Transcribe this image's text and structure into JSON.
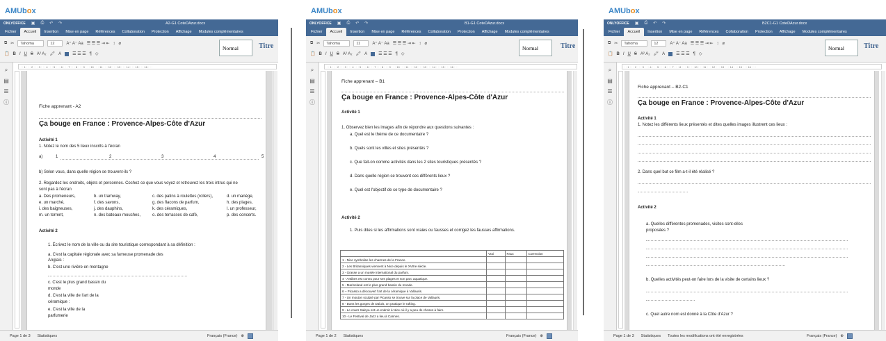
{
  "brand": {
    "a": "AMUb",
    "o": "o",
    "x": "x"
  },
  "onlyoffice": "ONLYOFFICE",
  "menu": [
    "Fichier",
    "Accueil",
    "Insertion",
    "Mise en page",
    "Références",
    "Collaboration",
    "Protection",
    "Affichage",
    "Modules complémentaires"
  ],
  "toolbar": {
    "font": "Tahoma",
    "style_normal": "Normal",
    "style_titre": "Titre"
  },
  "panes": [
    {
      "doc_title": "A2-G1 CoteDAzur.docx",
      "font_size": "12",
      "page": "Page 1 de 3",
      "stats": "Statistiques",
      "lang": "Français (France)",
      "saved": ""
    },
    {
      "doc_title": "B1-G1 CoteDAzur.docx",
      "font_size": "11",
      "page": "Page 1 de 2",
      "stats": "Statistiques",
      "lang": "Français (France)",
      "saved": ""
    },
    {
      "doc_title": "B2C1-G1 CoteDAzur.docx",
      "font_size": "12",
      "page": "Page 1 de 3",
      "stats": "Statistiques",
      "lang": "Français (France)",
      "saved": "Toutes les modifications ont été enregistrées"
    }
  ],
  "doc1": {
    "header": "Fiche apprenant - A2",
    "title": "Ça bouge en France : Provence-Alpes-Côte d'Azur",
    "act1": "Activité 1",
    "q1": "1. Notez le nom des 5 lieux inscrits à l'écran",
    "a_label": "a)",
    "nums": [
      "1",
      "2",
      "3",
      "4",
      "5"
    ],
    "b_line": "b)       Selon vous, dans quelle région se trouvent-ils ?",
    "q2a": "2. Regardez les endroits, objets et personnes. Cochez ce que vous voyez et retrouvez les trois intrus qui ne",
    "q2b": "sont pas à l'écran",
    "grid": [
      [
        "a. Des promeneurs,",
        "b. un tramway,",
        "c. des patins à roulettes (rollers),",
        "d. un manège,"
      ],
      [
        "e. un marché,",
        "f. des savons,",
        "g. des flacons de parfum,",
        "h. des plages,"
      ],
      [
        "i. des baigneuses,",
        "j. des dauphins,",
        "k. des céramiques,",
        "l. un professeur,"
      ],
      [
        "m. un torrent,",
        "n. des bateaux mouches,",
        "o. des terrasses de café,",
        "p. des concerts."
      ]
    ],
    "act2": "Activité 2",
    "q21": "1.   Écrivez le nom de la ville ou du site touristique correspondant à sa définition :",
    "qa1": "a.   C'est la capitale régionale avec sa fameuse promenade des",
    "qa2": "Anglais :",
    "qb": "b.   C'est une rivière en montagne",
    "qc1": "c.   C'est le plus grand bassin du",
    "qc2": "monde",
    "qd1": "d.   C'est la ville de l'art de la",
    "qd2": "céramique :",
    "qe1": "e.   C'est la ville de la",
    "qe2": "parfumerie"
  },
  "doc2": {
    "header": "Fiche apprenant – B1",
    "title": "Ça bouge en France :  Provence-Alpes-Côte d'Azur",
    "act1": "Activité 1",
    "q1": "1. Observez bien les images afin de répondre aux questions suivantes :",
    "subs": [
      "a.   Quel est le thème de ce documentaire ?",
      "b.   Quels sont les villes et sites présentés ?",
      "c.   Que fait-on comme activités dans les 2 sites touristiques présentés ?",
      "d.   Dans quelle région se trouvent ces différents lieux ?",
      "e.   Quel est l'objectif de ce type de documentaire ?"
    ],
    "act2": "Activité 2",
    "q2": "1.   Puis dites si les affirmations sont vraies ou fausses et corrigez les fausses affirmations.",
    "cols": [
      "Vrai",
      "Faux",
      "Correction"
    ],
    "rows": [
      "1 - Nice symbolise les charmes de la France.",
      "2 - Les Britanniques viennent à Nice depuis le XVIIIe siècle.",
      "3 - Grasse a un musée international du parfum.",
      "4 - Antibes est connu pour ses plages et son parc aquatique.",
      "5 - Marineland est le plus grand bassin du monde.",
      "6 – Picasso a découvert l'art de la céramique à Vallauris.",
      "7 - Un mouton sculpté par Picasso se trouve sur la place de Vallauris.",
      "8 - Dans les gorges de Daluis, on pratique le rafting.",
      "9 - Le cours Saleya est un endroit à Nice où il y a peu de choses à faire.",
      "10 - Le Festival de Jazz a lieu à Cannes."
    ]
  },
  "doc3": {
    "header": "Fiche apprenant – B2-C1",
    "title": "Ça bouge en France : Provence-Alpes-Côte d'Azur",
    "act1": "Activité 1",
    "q1": "1. Notez les différents lieux présentés et dites quelles images illustrent ces lieux :",
    "q2": "2. Dans quel but ce film a-t-il été réalisé ?",
    "act2": "Activité 2",
    "qa1": "a.   Quelles différentes promenades, visites sont-elles",
    "qa2": "proposées ?",
    "qb": "b.   Quelles activités peut-on faire lors de la visite de certains lieux ?",
    "qc": "c.  Quel autre nom est donné à la Côte d'Azur ?"
  },
  "colors": {
    "accent": "#446995",
    "brand": "#3d87c7",
    "brand_o": "#e88b1d"
  }
}
